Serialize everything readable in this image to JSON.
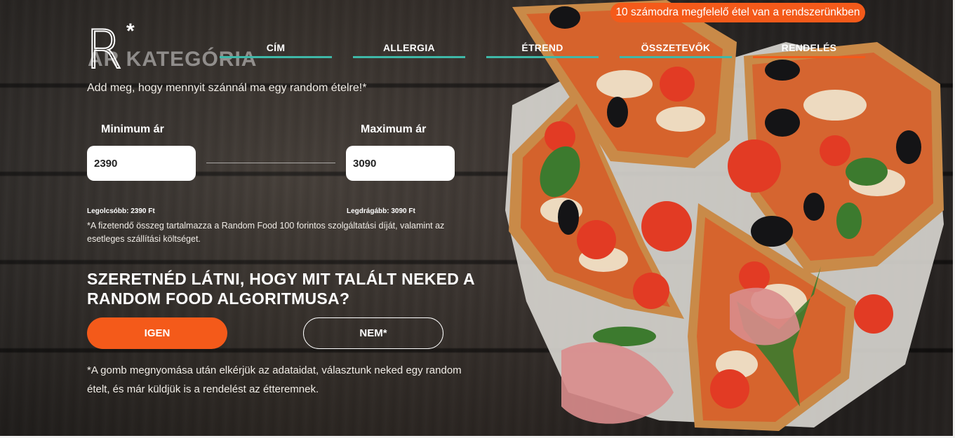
{
  "brand": {
    "logo_letter": "R",
    "logo_mark": "*"
  },
  "banner": {
    "text": "10 számodra megfelelő étel van a rendszerünkben"
  },
  "ghost_title": "ÁR KATEGÓRIA",
  "nav": {
    "items": [
      {
        "label": "CÍM"
      },
      {
        "label": "ALLERGIA"
      },
      {
        "label": "ÉTREND"
      },
      {
        "label": "ÖSSZETEVŐK"
      },
      {
        "label": "RENDELÉS"
      }
    ]
  },
  "intro": "Add meg, hogy mennyit szánnál ma egy random ételre!*",
  "price": {
    "min_label": "Minimum ár",
    "max_label": "Maximum ár",
    "min_value": "2390",
    "max_value": "3090",
    "cheapest": "Legolcsóbb: 2390 Ft",
    "most_expensive": "Legdrágább: 3090 Ft",
    "note": "*A fizetendő összeg tartalmazza a Random Food 100 forintos szolgáltatási díját, valamint az esetleges szállítási költséget."
  },
  "question": "SZERETNÉD LÁTNI, HOGY MIT TALÁLT NEKED A RANDOM FOOD ALGORITMUSA?",
  "buttons": {
    "yes": "IGEN",
    "no": "NEM*"
  },
  "footnote": "*A gomb megnyomása után elkérjük az adataidat, választunk neked egy random ételt, és már küldjük is a rendelést az étteremnek.",
  "colors": {
    "accent": "#f45a1a",
    "teal": "#3fb8a8"
  }
}
